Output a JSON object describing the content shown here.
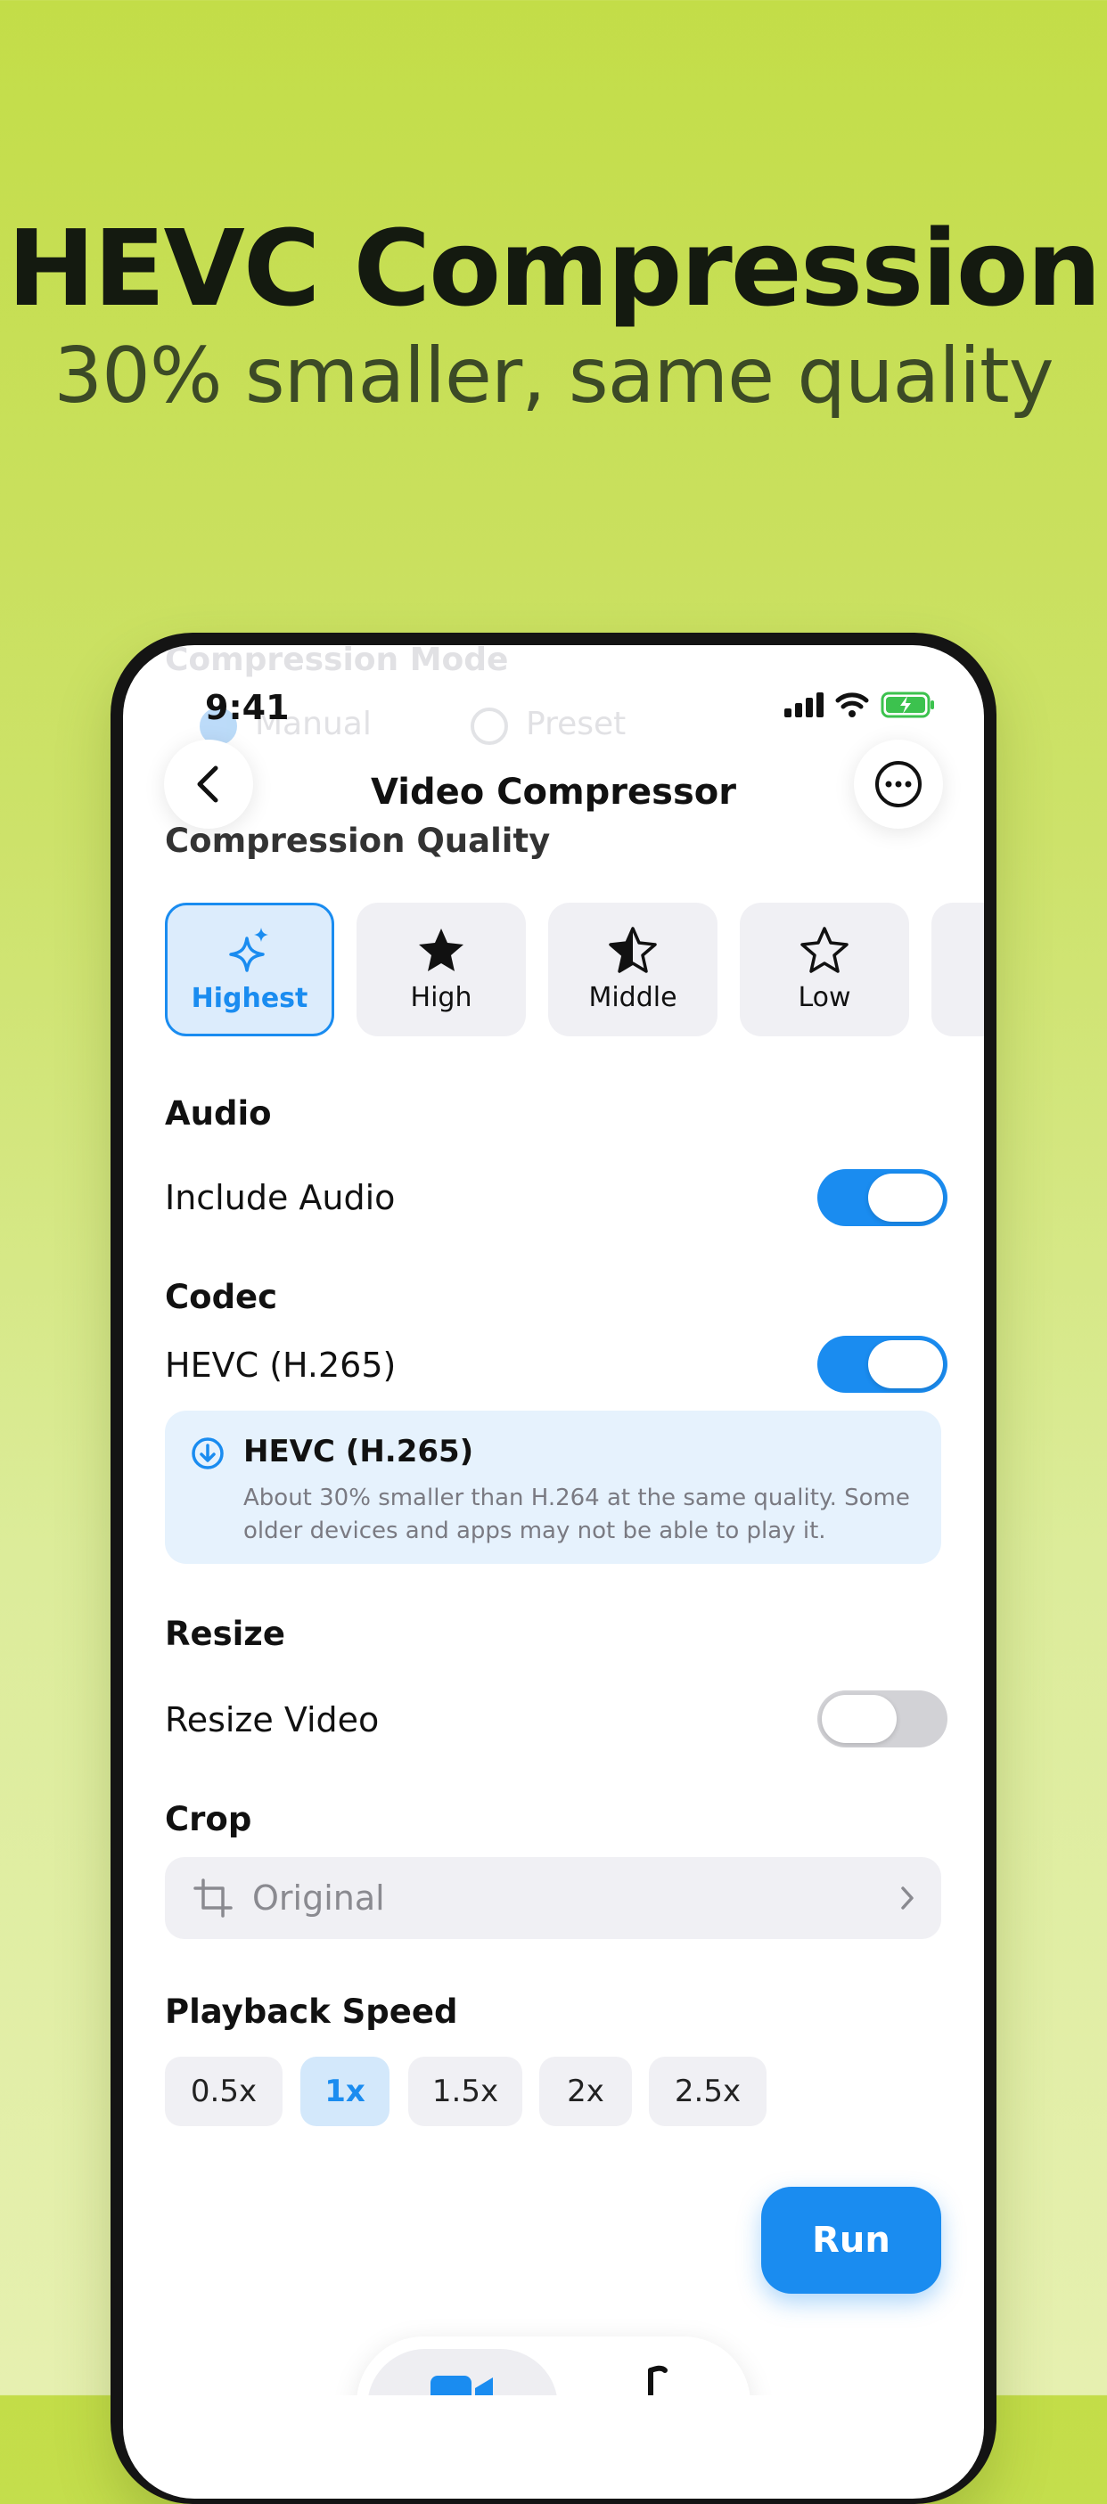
{
  "hero": {
    "title": "HEVC Compression",
    "subtitle": "30% smaller, same quality"
  },
  "ghost": {
    "section": "Compression Mode",
    "option_manual": "Manual",
    "option_preset": "Preset"
  },
  "status_bar": {
    "time": "9:41"
  },
  "nav": {
    "title": "Video Compressor",
    "back_icon": "chevron-left-icon",
    "more_icon": "ellipsis-circle-icon"
  },
  "quality": {
    "label": "Compression Quality",
    "options": [
      {
        "label": "Highest",
        "icon": "sparkles-icon",
        "selected": true
      },
      {
        "label": "High",
        "icon": "star-filled-icon",
        "selected": false
      },
      {
        "label": "Middle",
        "icon": "star-half-icon",
        "selected": false
      },
      {
        "label": "Low",
        "icon": "star-outline-icon",
        "selected": false
      }
    ]
  },
  "audio": {
    "label": "Audio",
    "include_label": "Include Audio",
    "include_on": true
  },
  "codec": {
    "label": "Codec",
    "hevc_label": "HEVC (H.265)",
    "hevc_on": true,
    "info_title": "HEVC (H.265)",
    "info_text": "About 30% smaller than H.264 at the same quality. Some older devices and apps may not be able to play it."
  },
  "resize": {
    "label": "Resize",
    "resize_label": "Resize Video",
    "resize_on": false
  },
  "crop": {
    "label": "Crop",
    "value": "Original"
  },
  "playback": {
    "label": "Playback Speed",
    "options": [
      "0.5x",
      "1x",
      "1.5x",
      "2x",
      "2.5x"
    ],
    "selected": "1x"
  },
  "actions": {
    "run_label": "Run"
  },
  "colors": {
    "accent": "#1a8cf0",
    "background_top": "#c3dd48",
    "background_bottom": "#e6f0b0"
  }
}
